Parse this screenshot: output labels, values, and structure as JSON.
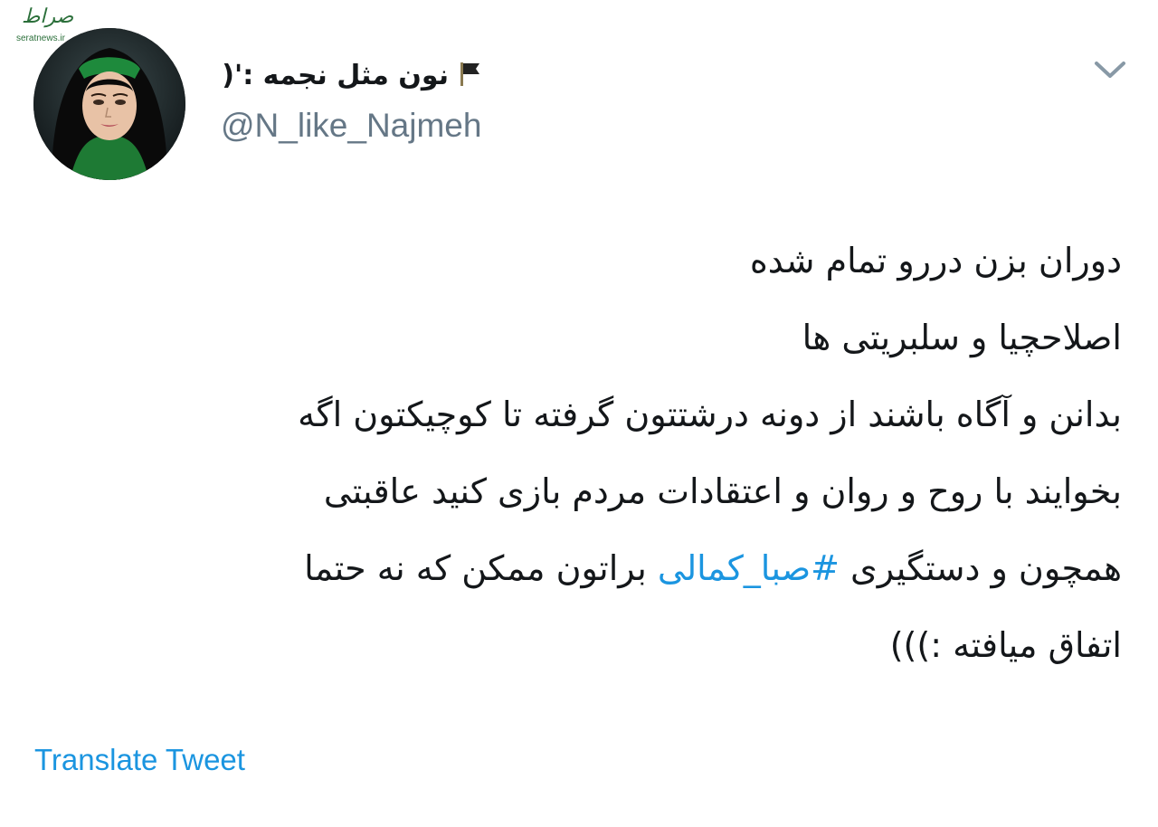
{
  "watermark": {
    "logo": "صراط",
    "tag": "seratnews.ir"
  },
  "tweet": {
    "author": {
      "flag_icon": "black-flag",
      "display_name": "نون مثل نجمه :'(",
      "handle": "@N_like_Najmeh"
    },
    "menu_icon": "chevron-down-icon",
    "body": {
      "line1": "دوران بزن دررو تمام شده",
      "line2": "اصلاحچیا و سلبریتی ها",
      "line3": "بدانن و آگاه باشند از دونه درشتتون گرفته تا کوچیکتون اگه",
      "line4": "بخوایند با روح و روان و اعتقادات مردم بازی کنید عاقبتی",
      "line5_start": "همچون و دستگیری ",
      "line5_hashtag": "#صبا_کمالی",
      "line5_end": " براتون ممکن که نه حتما",
      "line6": "اتفاق میافته :)))"
    },
    "translate_label": "Translate Tweet"
  },
  "colors": {
    "link": "#1b95e0",
    "text": "#14171a",
    "secondary": "#657786"
  }
}
